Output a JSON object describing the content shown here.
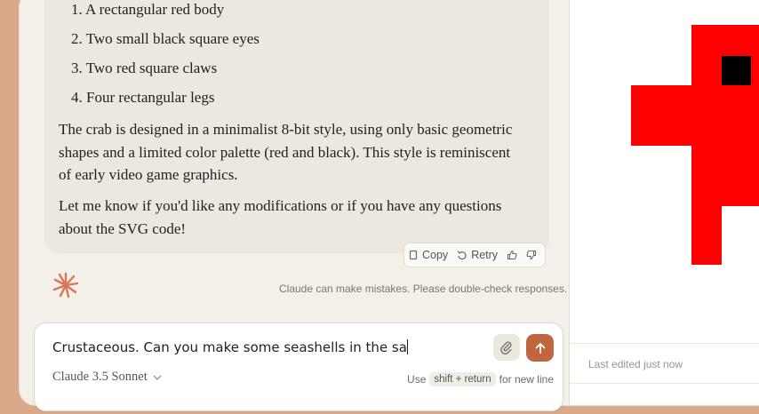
{
  "message": {
    "list_items": [
      "1. A rectangular red body",
      "2. Two small black square eyes",
      "3. Two red square claws",
      "4. Four rectangular legs"
    ],
    "paragraph_1": "The crab is designed in a minimalist 8-bit style, using only basic geometric shapes and a limited color palette (red and black). This style is reminiscent of early video game graphics.",
    "paragraph_2": "Let me know if you'd like any modifications or if you have any questions about the SVG code!"
  },
  "actions": {
    "copy_label": "Copy",
    "retry_label": "Retry"
  },
  "disclaimer": "Claude can make mistakes. Please double-check responses.",
  "composer": {
    "input_value": "Crustaceous. Can you make some seashells in the sa",
    "model_label": "Claude 3.5 Sonnet",
    "hint_use": "Use",
    "hint_keys": "shift + return",
    "hint_suffix": "for new line"
  },
  "artifact": {
    "last_edited": "Last edited just now"
  },
  "colors": {
    "accent": "#c0653f",
    "crab_red": "#ff0000",
    "crab_eye": "#000000"
  },
  "icons": [
    "copy-icon",
    "retry-icon",
    "thumbs-up-icon",
    "thumbs-down-icon",
    "claude-logo-icon",
    "paperclip-icon",
    "arrow-up-icon",
    "chevron-down-icon"
  ]
}
